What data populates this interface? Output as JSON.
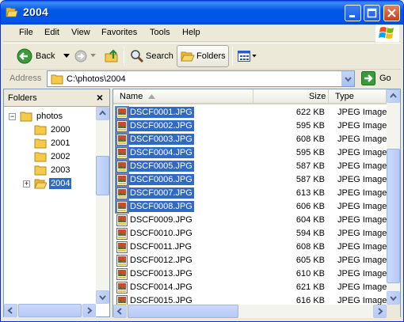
{
  "window": {
    "title": "2004"
  },
  "menu": [
    "File",
    "Edit",
    "View",
    "Favorites",
    "Tools",
    "Help"
  ],
  "toolbar": {
    "back": "Back",
    "search": "Search",
    "folders": "Folders"
  },
  "address": {
    "label": "Address",
    "path": "C:\\photos\\2004",
    "go": "Go"
  },
  "folders_pane": {
    "title": "Folders",
    "close": "×",
    "tree": [
      {
        "label": "photos",
        "level": 0,
        "expander": "−",
        "selected": false
      },
      {
        "label": "2000",
        "level": 1,
        "expander": "",
        "selected": false
      },
      {
        "label": "2001",
        "level": 1,
        "expander": "",
        "selected": false
      },
      {
        "label": "2002",
        "level": 1,
        "expander": "",
        "selected": false
      },
      {
        "label": "2003",
        "level": 1,
        "expander": "",
        "selected": false
      },
      {
        "label": "2004",
        "level": 1,
        "expander": "+",
        "selected": true
      }
    ]
  },
  "file_list": {
    "columns": {
      "name": "Name",
      "size": "Size",
      "type": "Type"
    },
    "files": [
      {
        "name": "DSCF0001.JPG",
        "size": "622 KB",
        "type": "JPEG Image",
        "selected": true
      },
      {
        "name": "DSCF0002.JPG",
        "size": "595 KB",
        "type": "JPEG Image",
        "selected": true
      },
      {
        "name": "DSCF0003.JPG",
        "size": "608 KB",
        "type": "JPEG Image",
        "selected": true
      },
      {
        "name": "DSCF0004.JPG",
        "size": "595 KB",
        "type": "JPEG Image",
        "selected": true
      },
      {
        "name": "DSCF0005.JPG",
        "size": "587 KB",
        "type": "JPEG Image",
        "selected": true
      },
      {
        "name": "DSCF0006.JPG",
        "size": "587 KB",
        "type": "JPEG Image",
        "selected": true
      },
      {
        "name": "DSCF0007.JPG",
        "size": "613 KB",
        "type": "JPEG Image",
        "selected": true
      },
      {
        "name": "DSCF0008.JPG",
        "size": "606 KB",
        "type": "JPEG Image",
        "selected": true
      },
      {
        "name": "DSCF0009.JPG",
        "size": "604 KB",
        "type": "JPEG Image",
        "selected": false
      },
      {
        "name": "DSCF0010.JPG",
        "size": "594 KB",
        "type": "JPEG Image",
        "selected": false
      },
      {
        "name": "DSCF0011.JPG",
        "size": "608 KB",
        "type": "JPEG Image",
        "selected": false
      },
      {
        "name": "DSCF0012.JPG",
        "size": "605 KB",
        "type": "JPEG Image",
        "selected": false
      },
      {
        "name": "DSCF0013.JPG",
        "size": "610 KB",
        "type": "JPEG Image",
        "selected": false
      },
      {
        "name": "DSCF0014.JPG",
        "size": "621 KB",
        "type": "JPEG Image",
        "selected": false
      },
      {
        "name": "DSCF0015.JPG",
        "size": "616 KB",
        "type": "JPEG Image",
        "selected": false
      }
    ]
  },
  "icons": {
    "title": "folder-open-icon",
    "back": "back-arrow-icon",
    "forward": "forward-arrow-icon",
    "up": "up-folder-icon",
    "search": "search-icon",
    "folders": "folders-icon",
    "views": "views-icon",
    "go": "go-arrow-icon",
    "file": "jpeg-file-icon"
  },
  "colors": {
    "titlebar": "#0058e6",
    "selection": "#316ac5",
    "close_button": "#c4411b"
  }
}
